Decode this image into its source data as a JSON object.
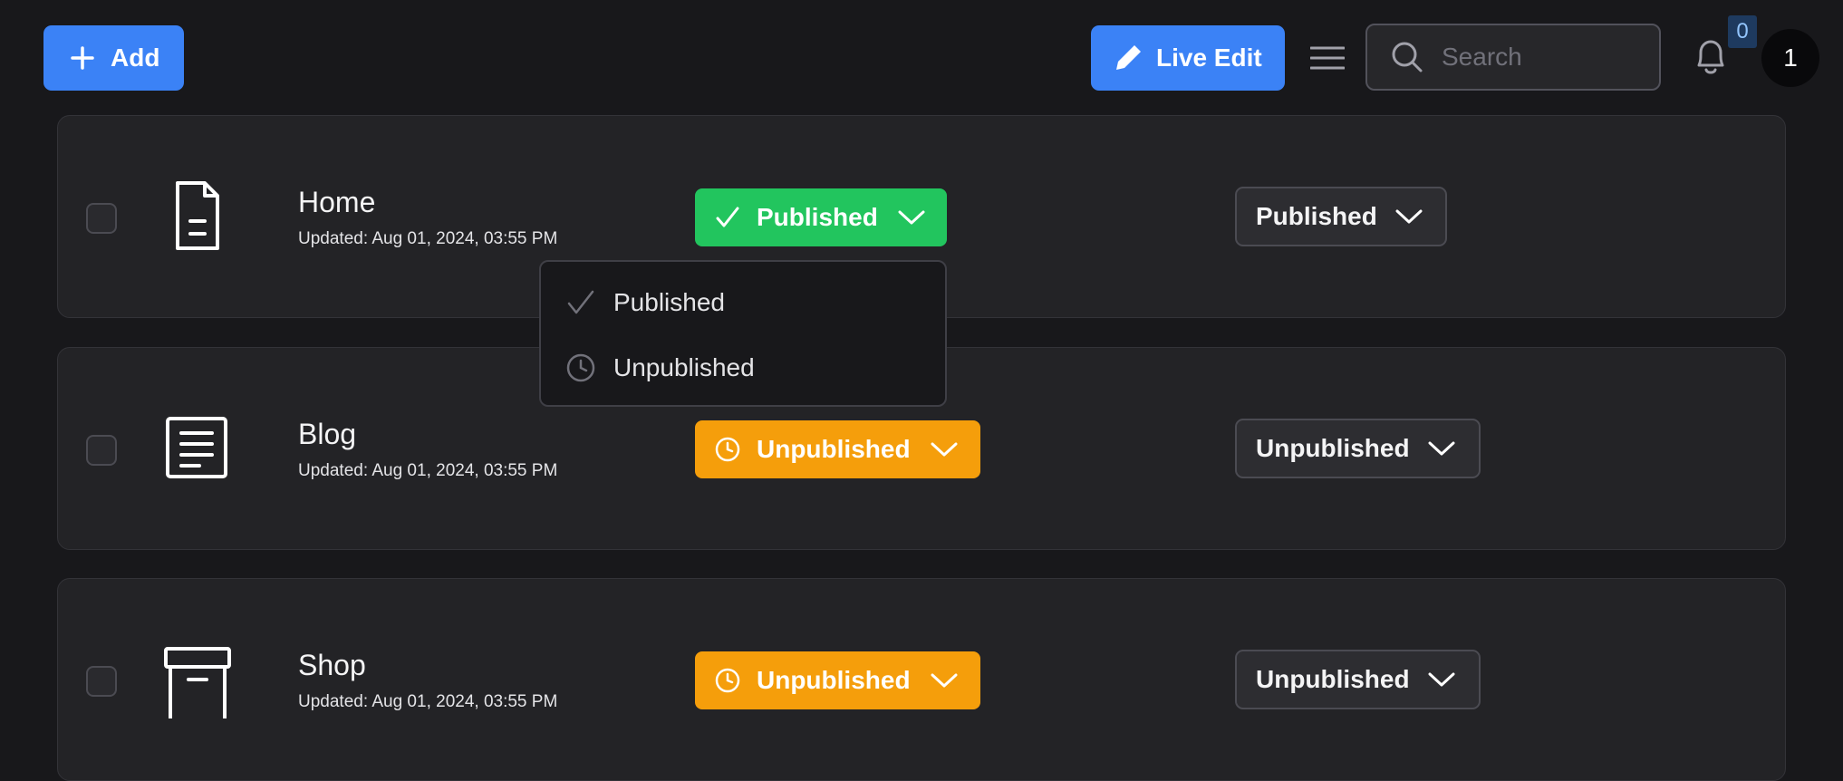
{
  "topbar": {
    "add_label": "Add",
    "live_edit_label": "Live Edit",
    "search_placeholder": "Search",
    "notification_count": "0",
    "avatar_initial": "1"
  },
  "rows": [
    {
      "name": "Home",
      "updated": "Updated: Aug 01, 2024, 03:55 PM",
      "icon": "document-icon",
      "status": "Published",
      "status_color": "#22c55e",
      "secondary_status": "Published"
    },
    {
      "name": "Blog",
      "updated": "Updated: Aug 01, 2024, 03:55 PM",
      "icon": "article-icon",
      "status": "Unpublished",
      "status_color": "#f59e0b",
      "secondary_status": "Unpublished"
    },
    {
      "name": "Shop",
      "updated": "Updated: Aug 01, 2024, 03:55 PM",
      "icon": "archive-box-icon",
      "status": "Unpublished",
      "status_color": "#f59e0b",
      "secondary_status": "Unpublished"
    }
  ],
  "status_dropdown": {
    "options": [
      "Published",
      "Unpublished"
    ]
  }
}
